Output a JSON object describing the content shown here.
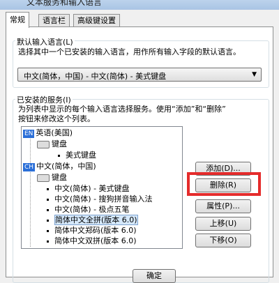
{
  "window": {
    "title": "文本服务和输入语言"
  },
  "tabs": [
    {
      "label": "常规",
      "active": true
    },
    {
      "label": "语言栏",
      "active": false
    },
    {
      "label": "高级键设置",
      "active": false
    }
  ],
  "default_group": {
    "title": "默认输入语言(L)",
    "description": "选择其中一个已安装的输入语言，用作所有输入字段的默认语言。",
    "selected": "中文(简体，中国) - 中文(简体) - 美式键盘"
  },
  "installed_group": {
    "title": "已安装的服务(I)",
    "description_line1": "为列表中显示的每个输入语言选择服务。使用“添加”和“删除”",
    "description_line2": "按钮来修改这个列表。"
  },
  "tree": {
    "lang1": {
      "badge": "EN",
      "label": "英语(美国)"
    },
    "lang1_keyboard": "键盘",
    "lang1_item": "美式键盘",
    "lang2": {
      "badge": "CH",
      "label": "中文(简体，中国)"
    },
    "lang2_keyboard": "键盘",
    "items": [
      "中文(简体) - 美式键盘",
      "中文(简体) - 搜狗拼音输入法",
      "中文(简体) - 极点五笔",
      "简体中文全拼(版本 6.0)",
      "简体中文郑码(版本 6.0)",
      "简体中文双拼(版本 6.0)"
    ],
    "selected_index": 3
  },
  "buttons": {
    "add": "添加(D)...",
    "remove": "删除(R)",
    "properties": "属性(P)...",
    "move_up": "上移(U)",
    "move_down": "下移(O)",
    "ok": "确定"
  },
  "icons": {
    "keyboard": "keyboard-icon",
    "dropdown": "chevron-down-icon"
  }
}
